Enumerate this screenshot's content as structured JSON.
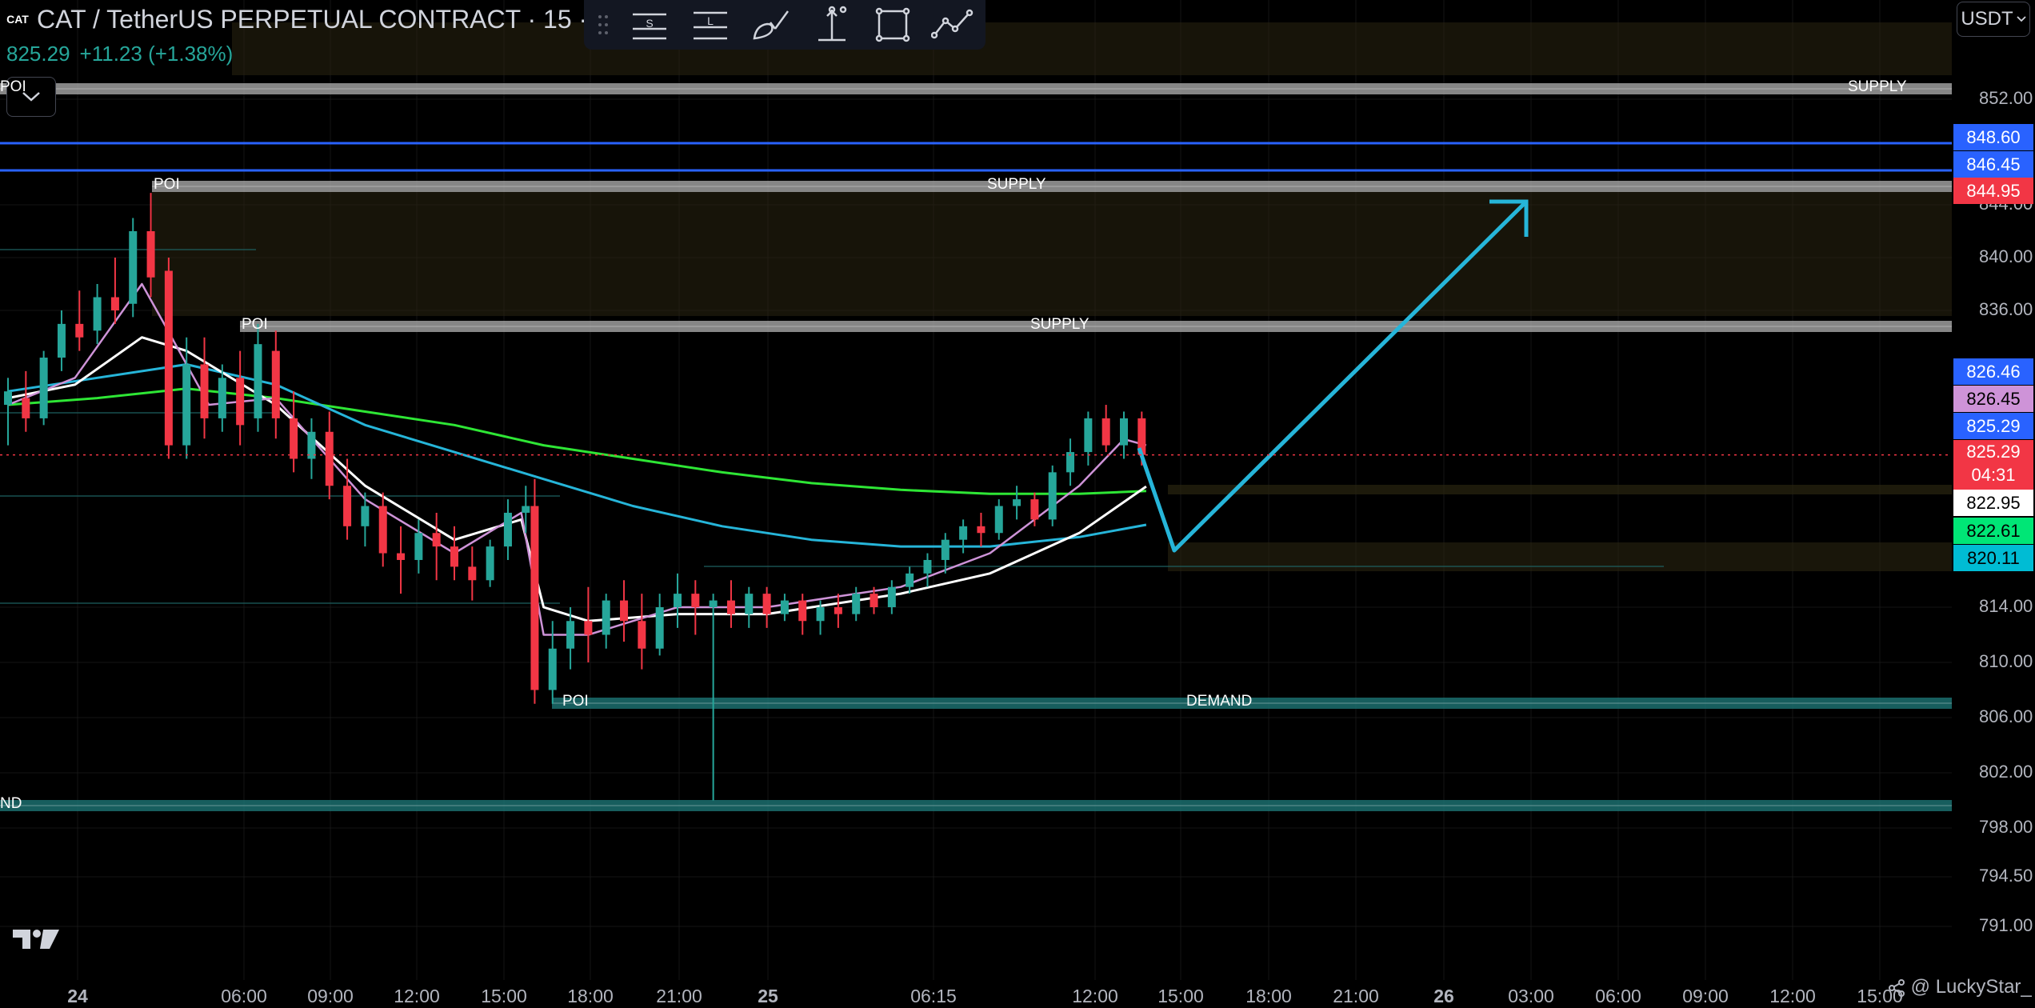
{
  "header": {
    "logo_text": "CAT",
    "title": "CAT / TetherUS PERPETUAL CONTRACT · 15 · B",
    "last_price": "825.29",
    "change": "+11.23 (+1.38%)",
    "collapse_icon": "chevron-down-icon"
  },
  "toolbar": {
    "tools": [
      {
        "name": "drag-handle-icon"
      },
      {
        "name": "short-position-icon",
        "label": "S"
      },
      {
        "name": "long-position-icon",
        "label": "L"
      },
      {
        "name": "brush-icon"
      },
      {
        "name": "price-range-icon"
      },
      {
        "name": "rectangle-icon"
      },
      {
        "name": "path-icon"
      }
    ]
  },
  "currency_selector": {
    "value": "USDT"
  },
  "price_axis": {
    "labels": [
      "852.00",
      "844.00",
      "840.00",
      "836.00",
      "814.00",
      "810.00",
      "806.00",
      "802.00",
      "798.00",
      "794.50",
      "791.00"
    ]
  },
  "price_tags": [
    {
      "value": "848.60",
      "bg": "#2962ff",
      "color": "#ffffff"
    },
    {
      "value": "846.45",
      "bg": "#2962ff",
      "color": "#ffffff"
    },
    {
      "value": "844.95",
      "bg": "#f23645",
      "color": "#ffffff"
    },
    {
      "value": "826.46",
      "bg": "#2962ff",
      "color": "#ffffff"
    },
    {
      "value": "826.45",
      "bg": "#ce93d8",
      "color": "#000000"
    },
    {
      "value": "825.29",
      "bg": "#2962ff",
      "color": "#ffffff"
    },
    {
      "value": "825.29",
      "bg": "#f23645",
      "color": "#ffffff",
      "countdown": "04:31"
    },
    {
      "value": "822.95",
      "bg": "#ffffff",
      "color": "#000000"
    },
    {
      "value": "822.61",
      "bg": "#00e676",
      "color": "#000000"
    },
    {
      "value": "820.11",
      "bg": "#00bcd4",
      "color": "#000000"
    }
  ],
  "time_axis": {
    "labels": [
      "24",
      "06:00",
      "09:00",
      "12:00",
      "15:00",
      "18:00",
      "21:00",
      "25",
      "06:15",
      "12:00",
      "15:00",
      "18:00",
      "21:00",
      "26",
      "03:00",
      "06:00",
      "09:00",
      "12:00",
      "15:00"
    ]
  },
  "zones": [
    {
      "kind": "supply",
      "label": "SUPPLY",
      "poi_label": "POI",
      "top": 852.9,
      "bottom": 852.1
    },
    {
      "kind": "supply",
      "label": "SUPPLY",
      "poi_label": "POI",
      "top": 845.5,
      "bottom": 844.8
    },
    {
      "kind": "supply",
      "label": "SUPPLY",
      "poi_label": "POI",
      "top": 835.2,
      "bottom": 834.5
    },
    {
      "kind": "demand",
      "label": "DEMAND",
      "poi_label": "POI",
      "top": 807.4,
      "bottom": 806.8
    },
    {
      "kind": "demand",
      "label": "ND",
      "top": 800.3,
      "bottom": 799.6
    }
  ],
  "horizontal_lines": [
    {
      "price": 848.6,
      "color": "#2962ff"
    },
    {
      "price": 846.45,
      "color": "#2962ff"
    }
  ],
  "chart_data": {
    "type": "candlestick",
    "symbol": "CAT / TetherUS PERPETUAL CONTRACT",
    "interval": "15",
    "ylim": [
      789.5,
      857.0
    ],
    "x_domain_hours": [
      0,
      82
    ],
    "ohlc": [
      {
        "t": 0.0,
        "o": 829.0,
        "h": 831.0,
        "c": 830.0,
        "l": 826.0
      },
      {
        "t": 0.8,
        "o": 829.5,
        "h": 831.5,
        "c": 828.0,
        "l": 827.0
      },
      {
        "t": 1.6,
        "o": 828.0,
        "h": 833.0,
        "c": 832.5,
        "l": 827.5
      },
      {
        "t": 2.4,
        "o": 832.5,
        "h": 836.0,
        "c": 835.0,
        "l": 831.5
      },
      {
        "t": 3.2,
        "o": 835.0,
        "h": 837.5,
        "c": 834.0,
        "l": 833.0
      },
      {
        "t": 4.0,
        "o": 834.5,
        "h": 838.0,
        "c": 837.0,
        "l": 833.5
      },
      {
        "t": 4.8,
        "o": 837.0,
        "h": 840.0,
        "c": 836.0,
        "l": 835.0
      },
      {
        "t": 5.6,
        "o": 836.5,
        "h": 843.0,
        "c": 842.0,
        "l": 835.5
      },
      {
        "t": 6.4,
        "o": 842.0,
        "h": 844.9,
        "c": 838.5,
        "l": 837.0
      },
      {
        "t": 7.2,
        "o": 839.0,
        "h": 840.0,
        "c": 826.0,
        "l": 825.0
      },
      {
        "t": 8.0,
        "o": 826.0,
        "h": 834.0,
        "c": 832.0,
        "l": 825.0
      },
      {
        "t": 8.8,
        "o": 832.0,
        "h": 834.0,
        "c": 828.0,
        "l": 826.5
      },
      {
        "t": 9.6,
        "o": 828.0,
        "h": 832.0,
        "c": 831.0,
        "l": 827.0
      },
      {
        "t": 10.4,
        "o": 831.0,
        "h": 833.0,
        "c": 827.5,
        "l": 826.0
      },
      {
        "t": 11.2,
        "o": 828.0,
        "h": 835.0,
        "c": 833.5,
        "l": 827.0
      },
      {
        "t": 12.0,
        "o": 833.0,
        "h": 834.5,
        "c": 828.0,
        "l": 826.5
      },
      {
        "t": 12.8,
        "o": 828.0,
        "h": 830.0,
        "c": 825.0,
        "l": 824.0
      },
      {
        "t": 13.6,
        "o": 825.0,
        "h": 828.0,
        "c": 827.0,
        "l": 823.5
      },
      {
        "t": 14.4,
        "o": 827.0,
        "h": 828.5,
        "c": 823.0,
        "l": 822.0
      },
      {
        "t": 15.2,
        "o": 823.0,
        "h": 825.0,
        "c": 820.0,
        "l": 819.0
      },
      {
        "t": 16.0,
        "o": 820.0,
        "h": 822.5,
        "c": 821.5,
        "l": 818.5
      },
      {
        "t": 16.8,
        "o": 821.5,
        "h": 822.5,
        "c": 818.0,
        "l": 817.0
      },
      {
        "t": 17.6,
        "o": 818.0,
        "h": 820.0,
        "c": 817.5,
        "l": 815.0
      },
      {
        "t": 18.4,
        "o": 817.5,
        "h": 820.5,
        "c": 819.5,
        "l": 816.5
      },
      {
        "t": 19.2,
        "o": 819.5,
        "h": 821.0,
        "c": 818.5,
        "l": 816.0
      },
      {
        "t": 20.0,
        "o": 818.5,
        "h": 820.0,
        "c": 817.0,
        "l": 816.0
      },
      {
        "t": 20.8,
        "o": 817.0,
        "h": 818.5,
        "c": 816.0,
        "l": 814.5
      },
      {
        "t": 21.6,
        "o": 816.0,
        "h": 819.0,
        "c": 818.5,
        "l": 815.5
      },
      {
        "t": 22.4,
        "o": 818.5,
        "h": 822.0,
        "c": 821.0,
        "l": 817.5
      },
      {
        "t": 23.2,
        "o": 821.0,
        "h": 823.0,
        "c": 821.5,
        "l": 819.5
      },
      {
        "t": 23.6,
        "o": 821.5,
        "h": 823.5,
        "c": 808.0,
        "l": 807.0
      },
      {
        "t": 24.4,
        "o": 808.0,
        "h": 813.0,
        "c": 811.0,
        "l": 807.0
      },
      {
        "t": 25.2,
        "o": 811.0,
        "h": 814.0,
        "c": 813.0,
        "l": 809.5
      },
      {
        "t": 26.0,
        "o": 813.0,
        "h": 815.5,
        "c": 812.0,
        "l": 810.0
      },
      {
        "t": 26.8,
        "o": 812.0,
        "h": 815.0,
        "c": 814.5,
        "l": 811.0
      },
      {
        "t": 27.6,
        "o": 814.5,
        "h": 816.0,
        "c": 813.0,
        "l": 811.5
      },
      {
        "t": 28.4,
        "o": 813.0,
        "h": 815.0,
        "c": 811.0,
        "l": 809.5
      },
      {
        "t": 29.2,
        "o": 811.0,
        "h": 815.0,
        "c": 814.0,
        "l": 810.5
      },
      {
        "t": 30.0,
        "o": 814.0,
        "h": 816.5,
        "c": 815.0,
        "l": 812.5
      },
      {
        "t": 30.8,
        "o": 815.0,
        "h": 816.0,
        "c": 814.0,
        "l": 812.0
      },
      {
        "t": 31.6,
        "o": 814.0,
        "h": 815.0,
        "c": 814.5,
        "l": 800.0
      },
      {
        "t": 32.4,
        "o": 814.5,
        "h": 816.0,
        "c": 813.5,
        "l": 812.5
      },
      {
        "t": 33.2,
        "o": 813.5,
        "h": 815.5,
        "c": 815.0,
        "l": 812.5
      },
      {
        "t": 34.0,
        "o": 815.0,
        "h": 815.5,
        "c": 813.5,
        "l": 812.5
      },
      {
        "t": 34.8,
        "o": 813.5,
        "h": 815.0,
        "c": 814.5,
        "l": 813.0
      },
      {
        "t": 35.6,
        "o": 814.5,
        "h": 815.0,
        "c": 813.0,
        "l": 812.0
      },
      {
        "t": 36.4,
        "o": 813.0,
        "h": 814.5,
        "c": 814.0,
        "l": 812.0
      },
      {
        "t": 37.2,
        "o": 814.0,
        "h": 815.0,
        "c": 813.5,
        "l": 812.5
      },
      {
        "t": 38.0,
        "o": 813.5,
        "h": 815.5,
        "c": 815.0,
        "l": 813.0
      },
      {
        "t": 38.8,
        "o": 815.0,
        "h": 815.5,
        "c": 814.0,
        "l": 813.5
      },
      {
        "t": 39.6,
        "o": 814.0,
        "h": 816.0,
        "c": 815.5,
        "l": 813.5
      },
      {
        "t": 40.4,
        "o": 815.5,
        "h": 817.0,
        "c": 816.5,
        "l": 815.0
      },
      {
        "t": 41.2,
        "o": 816.5,
        "h": 818.0,
        "c": 817.5,
        "l": 815.5
      },
      {
        "t": 42.0,
        "o": 817.5,
        "h": 819.5,
        "c": 819.0,
        "l": 816.5
      },
      {
        "t": 42.8,
        "o": 819.0,
        "h": 820.5,
        "c": 820.0,
        "l": 818.0
      },
      {
        "t": 43.6,
        "o": 820.0,
        "h": 821.0,
        "c": 819.5,
        "l": 818.5
      },
      {
        "t": 44.4,
        "o": 819.5,
        "h": 822.0,
        "c": 821.5,
        "l": 819.0
      },
      {
        "t": 45.2,
        "o": 821.5,
        "h": 823.0,
        "c": 822.0,
        "l": 820.5
      },
      {
        "t": 46.0,
        "o": 822.0,
        "h": 822.5,
        "c": 820.5,
        "l": 820.0
      },
      {
        "t": 46.8,
        "o": 820.5,
        "h": 824.5,
        "c": 824.0,
        "l": 820.0
      },
      {
        "t": 47.6,
        "o": 824.0,
        "h": 826.5,
        "c": 825.5,
        "l": 823.0
      },
      {
        "t": 48.4,
        "o": 825.5,
        "h": 828.5,
        "c": 828.0,
        "l": 824.5
      },
      {
        "t": 49.2,
        "o": 828.0,
        "h": 829.0,
        "c": 826.0,
        "l": 825.5
      },
      {
        "t": 50.0,
        "o": 826.0,
        "h": 828.5,
        "c": 828.0,
        "l": 825.0
      },
      {
        "t": 50.8,
        "o": 828.0,
        "h": 828.5,
        "c": 825.29,
        "l": 824.5
      }
    ],
    "ema_white": [
      [
        0,
        829.5
      ],
      [
        3,
        830.5
      ],
      [
        6,
        834.0
      ],
      [
        8,
        833.0
      ],
      [
        12,
        829.0
      ],
      [
        16,
        823.0
      ],
      [
        20,
        819.0
      ],
      [
        23,
        820.5
      ],
      [
        24,
        814.0
      ],
      [
        26,
        813.0
      ],
      [
        30,
        813.5
      ],
      [
        34,
        813.5
      ],
      [
        40,
        815.0
      ],
      [
        44,
        816.5
      ],
      [
        48,
        819.5
      ],
      [
        51,
        822.95
      ]
    ],
    "ema_blue": [
      [
        0,
        830.0
      ],
      [
        4,
        831.0
      ],
      [
        8,
        832.0
      ],
      [
        12,
        830.5
      ],
      [
        16,
        827.5
      ],
      [
        20,
        825.5
      ],
      [
        24,
        823.5
      ],
      [
        28,
        821.5
      ],
      [
        32,
        820.0
      ],
      [
        36,
        819.0
      ],
      [
        40,
        818.5
      ],
      [
        44,
        818.5
      ],
      [
        48,
        819.2
      ],
      [
        51,
        820.11
      ]
    ],
    "ema_green": [
      [
        0,
        829.0
      ],
      [
        4,
        829.5
      ],
      [
        8,
        830.2
      ],
      [
        12,
        829.5
      ],
      [
        16,
        828.5
      ],
      [
        20,
        827.5
      ],
      [
        24,
        826.0
      ],
      [
        28,
        825.0
      ],
      [
        32,
        824.0
      ],
      [
        36,
        823.2
      ],
      [
        40,
        822.7
      ],
      [
        44,
        822.4
      ],
      [
        48,
        822.4
      ],
      [
        51,
        822.61
      ]
    ],
    "ema_pink": [
      [
        0,
        829.0
      ],
      [
        3,
        831.0
      ],
      [
        6,
        838.0
      ],
      [
        7,
        835.0
      ],
      [
        9,
        829.0
      ],
      [
        12,
        829.5
      ],
      [
        16,
        822.0
      ],
      [
        20,
        818.0
      ],
      [
        23,
        821.0
      ],
      [
        24,
        812.0
      ],
      [
        26,
        812.0
      ],
      [
        30,
        814.0
      ],
      [
        34,
        814.0
      ],
      [
        40,
        815.5
      ],
      [
        44,
        818.0
      ],
      [
        48,
        823.0
      ],
      [
        50,
        826.45
      ],
      [
        51,
        826.0
      ]
    ],
    "projection_path": [
      [
        51,
        826.0
      ],
      [
        52,
        819.6
      ],
      [
        67,
        843.5
      ]
    ],
    "type_note": "candlestick"
  }
}
